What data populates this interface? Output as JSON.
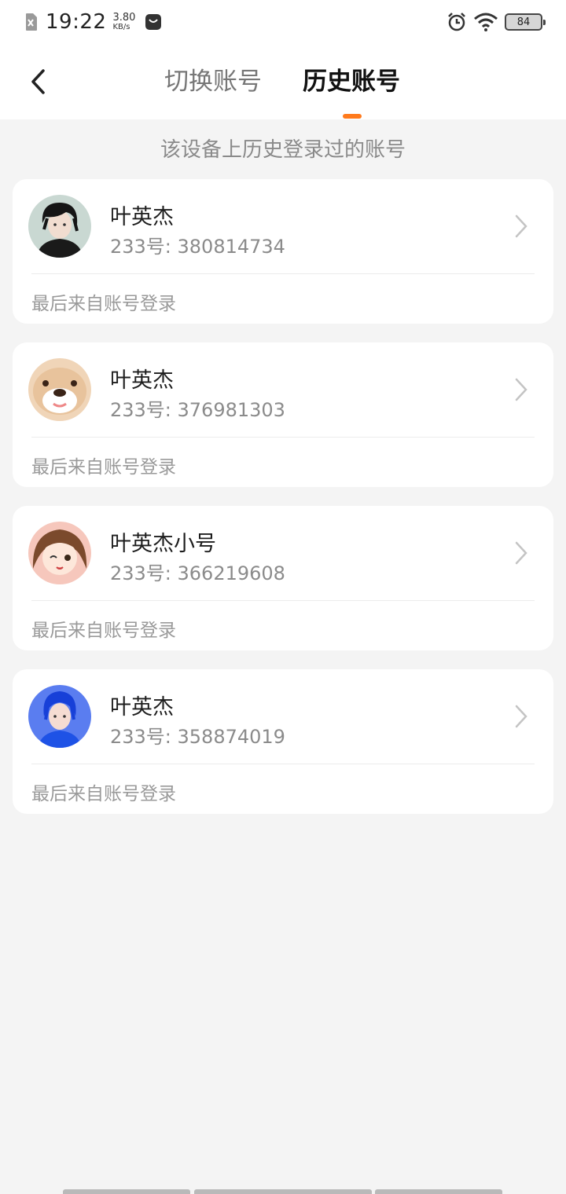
{
  "status_bar": {
    "time": "19:22",
    "net_speed_value": "3.80",
    "net_speed_unit": "KB/s",
    "battery": "84",
    "icons": [
      "sim-card-icon",
      "notification-icon",
      "alarm-icon",
      "wifi-icon",
      "battery-icon"
    ]
  },
  "header": {
    "tabs": [
      {
        "label": "切换账号",
        "active": false
      },
      {
        "label": "历史账号",
        "active": true
      }
    ],
    "accent_color": "#ff7a1c"
  },
  "subtitle": "该设备上历史登录过的账号",
  "accounts": [
    {
      "name": "叶英杰",
      "id_text": "233号: 380814734",
      "last_login": "最后来自账号登录",
      "avatar": "dark-hair-avatar"
    },
    {
      "name": "叶英杰",
      "id_text": "233号: 376981303",
      "last_login": "最后来自账号登录",
      "avatar": "puppy-avatar"
    },
    {
      "name": "叶英杰小号",
      "id_text": "233号: 366219608",
      "last_login": "最后来自账号登录",
      "avatar": "anime-girl-avatar"
    },
    {
      "name": "叶英杰",
      "id_text": "233号: 358874019",
      "last_login": "最后来自账号登录",
      "avatar": "blue-hair-avatar"
    }
  ]
}
